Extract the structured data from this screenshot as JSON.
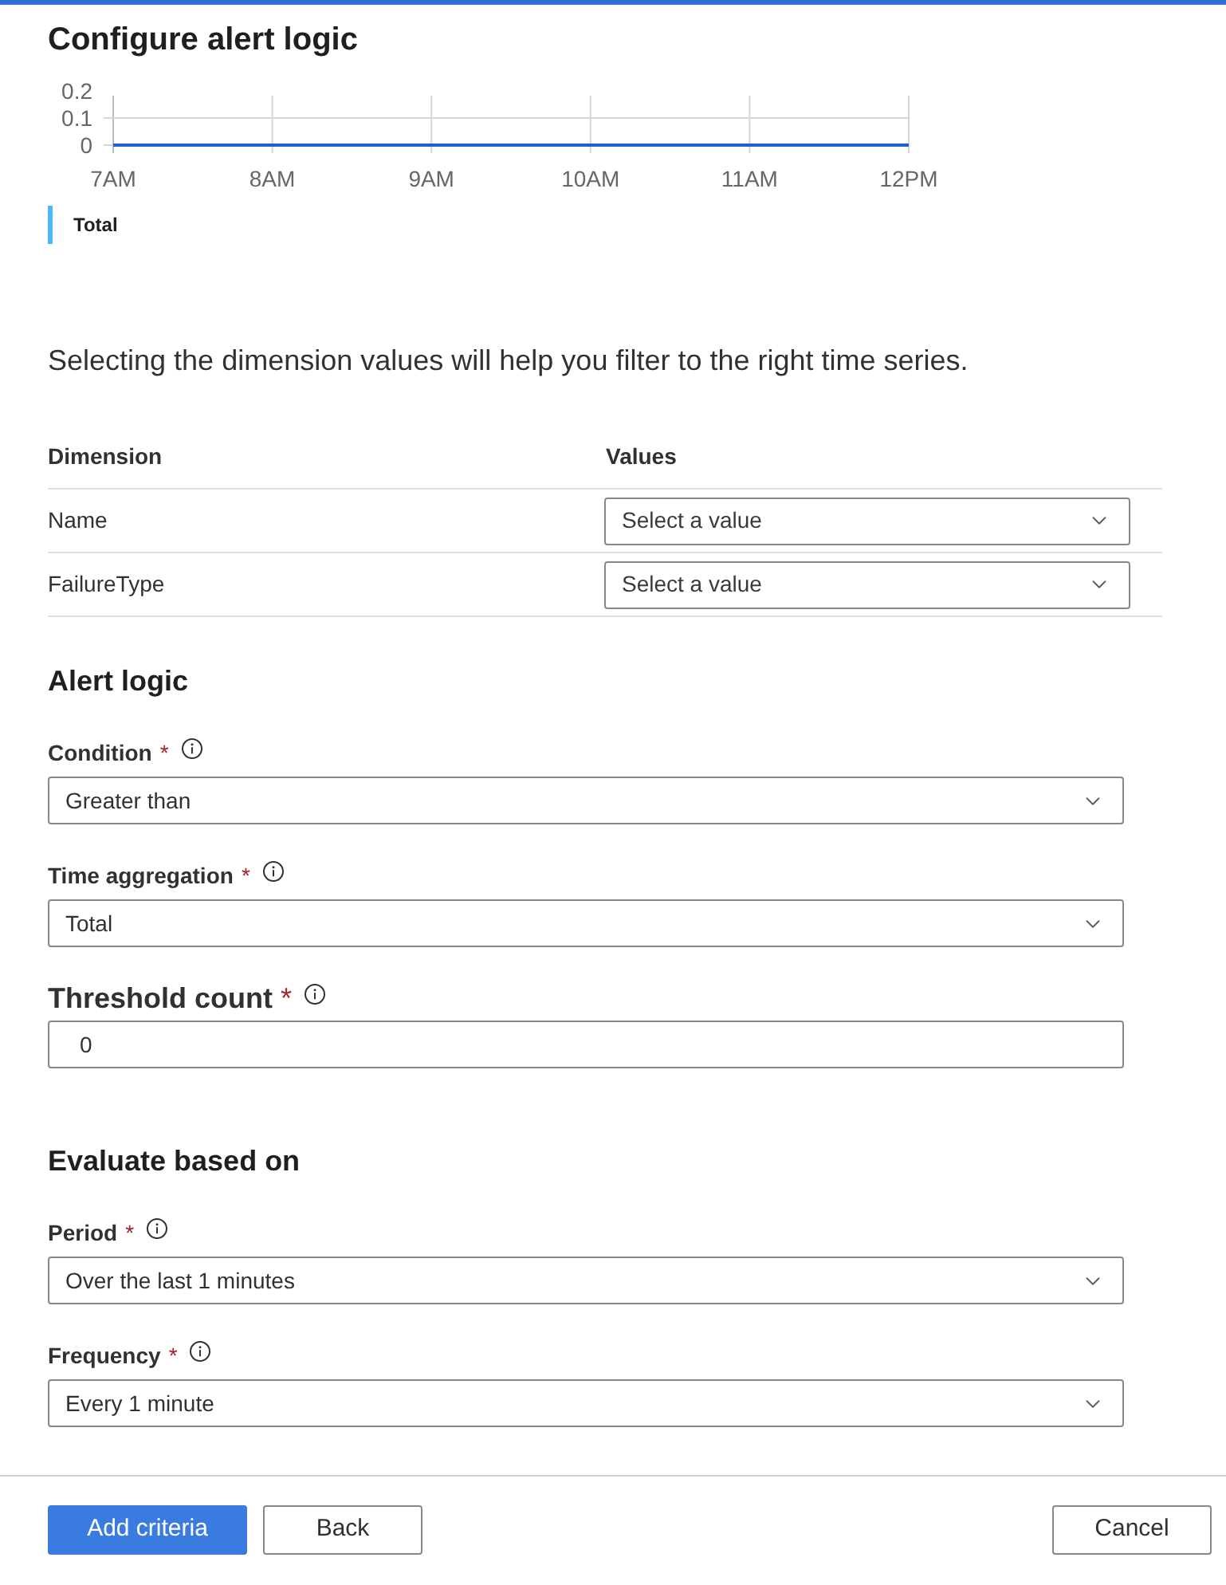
{
  "header": {
    "title": "Configure alert logic"
  },
  "chart": {
    "chart_data": {
      "type": "line",
      "x": [
        "7AM",
        "8AM",
        "9AM",
        "10AM",
        "11AM",
        "12PM"
      ],
      "series": [
        {
          "name": "Total",
          "color": "#1f5fd0",
          "values": [
            0,
            0,
            0,
            0,
            0,
            0
          ]
        }
      ],
      "ylim": [
        0,
        0.2
      ],
      "yticks": [
        0,
        0.1,
        0.2
      ],
      "grid": true
    }
  },
  "dimensions": {
    "intro": "Selecting the dimension values will help you filter to the right time series.",
    "columns": [
      "Dimension",
      "Values"
    ],
    "rows": [
      {
        "name": "Name",
        "placeholder": "Select a value"
      },
      {
        "name": "FailureType",
        "placeholder": "Select a value"
      }
    ]
  },
  "sections": [
    {
      "title": "Alert logic",
      "fields": [
        {
          "kind": "dropdown",
          "label": "Condition",
          "required_mark": "*",
          "value": "Greater than"
        },
        {
          "kind": "dropdown",
          "label": "Time aggregation",
          "required_mark": "*",
          "value": "Total"
        },
        {
          "kind": "textbox",
          "label": "Threshold count",
          "required_mark": "*",
          "value": "0"
        }
      ]
    },
    {
      "title": "Evaluate based on",
      "fields": [
        {
          "kind": "dropdown",
          "label": "Period",
          "required_mark": "*",
          "value": "Over the last 1 minutes"
        },
        {
          "kind": "dropdown",
          "label": "Frequency",
          "required_mark": "*",
          "value": "Every 1 minute"
        }
      ]
    }
  ],
  "footer": {
    "left_buttons": [
      {
        "label": "Add criteria",
        "kind": "primary"
      },
      {
        "label": "Back",
        "kind": "secondary"
      }
    ],
    "right_buttons": [
      {
        "label": "Cancel",
        "kind": "secondary"
      }
    ]
  }
}
